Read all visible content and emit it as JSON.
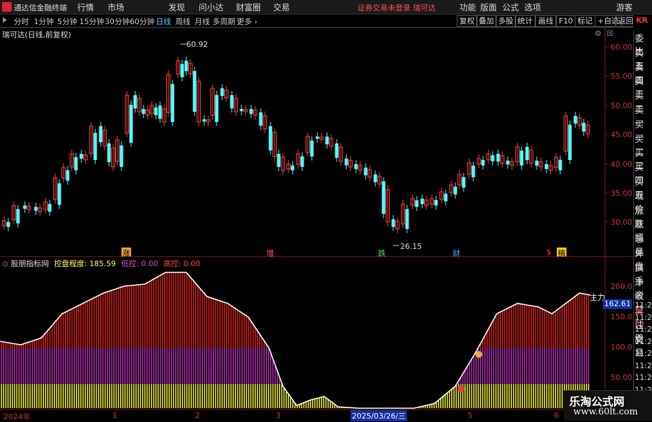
{
  "app": {
    "title": "通达信金融终端",
    "warning": "证券交易未登录   瑞可达"
  },
  "menu": [
    "行情",
    "市场",
    "发现",
    "问小达",
    "财富圈",
    "交易"
  ],
  "right_menu": [
    "功能",
    "版面",
    "公式",
    "选项",
    "画线",
    "游客"
  ],
  "periods": [
    "分时",
    "1分钟",
    "5分钟",
    "15分钟",
    "30分钟",
    "60分钟",
    "日线",
    "周线",
    "月线",
    "多周期",
    "更多 ›"
  ],
  "active_period": "日线",
  "tools": [
    "复权",
    "叠加",
    "多股",
    "统计",
    "画线",
    "F10",
    "标记",
    "+自选",
    "返回"
  ],
  "stock_title": "瑞可达(日线,前复权)",
  "side_labels": [
    "委比",
    "卖五",
    "卖四",
    "卖三",
    "卖二",
    "卖一",
    "买一",
    "买二",
    "买三",
    "买四",
    "买五",
    "现价",
    "涨跌",
    "涨幅",
    "总量",
    "外盘",
    "换手",
    "净资",
    "收益",
    "自动",
    "注册",
    "交易"
  ],
  "price_axis": [
    "60.00",
    "55.00",
    "50.00",
    "45.00",
    "40.00",
    "35.00",
    "30.00"
  ],
  "price_high": "60.92",
  "price_low": "26.15",
  "signals": [
    {
      "text": "涨",
      "color": "#f0a030"
    },
    {
      "text": "增",
      "color": "#ff6060"
    },
    {
      "text": "跌",
      "color": "#40e040"
    },
    {
      "text": "财",
      "color": "#60a0ff"
    },
    {
      "text": "$",
      "color": "#ff4040"
    },
    {
      "text": "稿",
      "color": "#ffcc00"
    }
  ],
  "indicator": {
    "name": "股朋指标网",
    "control_label": "控盘程度:",
    "control_value": "185.59",
    "low_label": "低控:",
    "low_value": "0.00",
    "high_label": "高控:",
    "high_value": "0.00",
    "main_label": "主力",
    "current_value": "162.61",
    "axis": [
      "200.0",
      "150.0",
      "100.0",
      "50.00"
    ]
  },
  "time_axis": [
    "2024年",
    "1",
    "2",
    "3",
    "2025/03/26/三",
    "5",
    "6"
  ],
  "side_times": [
    "11:29",
    "11:29",
    "11:29",
    "11:29",
    "11:29",
    "11:29",
    "11:29",
    "11:29",
    "11:29",
    "11:29"
  ],
  "watermark": {
    "title": "乐淘公式网",
    "url": "www.60lt.com"
  },
  "colors": {
    "up": "#ff3c3c",
    "down": "#54ffff",
    "fill_red": "#d42020",
    "fill_purple": "#b030b0",
    "fill_yellow": "#f0f040",
    "curve": "#ffffff"
  }
}
